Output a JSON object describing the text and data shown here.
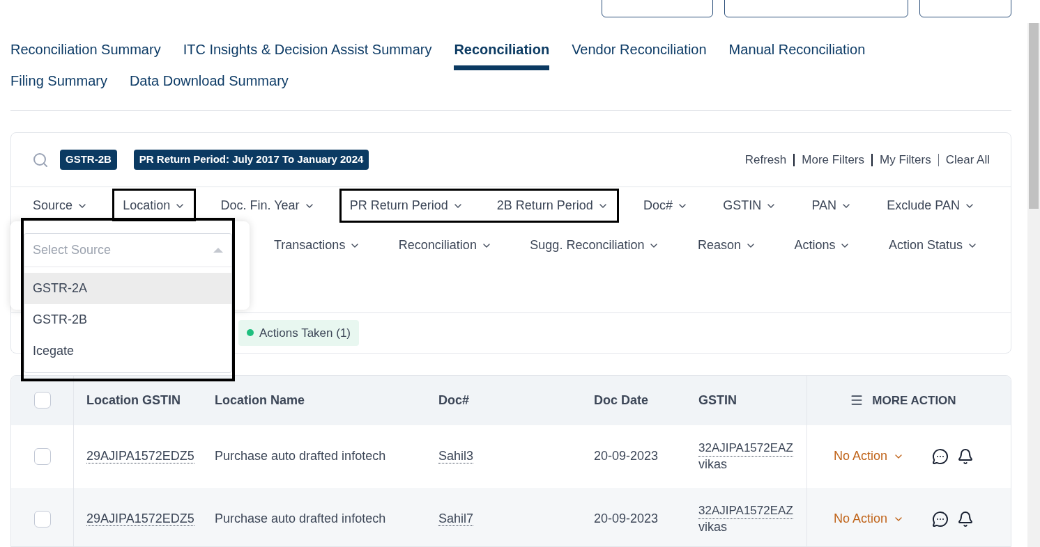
{
  "tabs": [
    {
      "label": "Reconciliation Summary",
      "selected": false
    },
    {
      "label": "ITC Insights & Decision Assist Summary",
      "selected": false
    },
    {
      "label": "Reconciliation",
      "selected": true
    },
    {
      "label": "Vendor Reconciliation",
      "selected": false
    },
    {
      "label": "Manual Reconciliation",
      "selected": false
    },
    {
      "label": "Filing Summary",
      "selected": false
    },
    {
      "label": "Data Download Summary",
      "selected": false
    }
  ],
  "applied_filters": [
    "GSTR-2B",
    "PR Return Period: July 2017 To January 2024"
  ],
  "filter_actions": [
    "Refresh",
    "More Filters",
    "My Filters",
    "Clear All"
  ],
  "filter_rows": [
    [
      {
        "label": "Source",
        "highlighted": false
      },
      {
        "label": "Location",
        "highlighted": true
      },
      {
        "label": "Doc. Fin. Year",
        "highlighted": false
      },
      {
        "label": "PR Return Period",
        "highlighted": true
      },
      {
        "label": "2B Return Period",
        "highlighted": true
      },
      {
        "label": "Doc#",
        "highlighted": false
      },
      {
        "label": "GSTIN",
        "highlighted": false
      },
      {
        "label": "PAN",
        "highlighted": false
      },
      {
        "label": "Exclude PAN",
        "highlighted": false
      }
    ],
    [
      {
        "label": "Transactions",
        "highlighted": false
      },
      {
        "label": "Reconciliation",
        "highlighted": false
      },
      {
        "label": "Sugg. Reconciliation",
        "highlighted": false
      },
      {
        "label": "Reason",
        "highlighted": false
      },
      {
        "label": "Actions",
        "highlighted": false
      },
      {
        "label": "Action Status",
        "highlighted": false
      }
    ]
  ],
  "status_chips": [
    {
      "label": "Actions Taken (1)",
      "color": "#1fbf7f"
    }
  ],
  "source_dropdown": {
    "placeholder": "Select Source",
    "expanded": true,
    "highlighted": true,
    "options": [
      {
        "label": "GSTR-2A",
        "selected": true
      },
      {
        "label": "GSTR-2B",
        "selected": false
      },
      {
        "label": "Icegate",
        "selected": false
      }
    ]
  },
  "table": {
    "columns": [
      "Location GSTIN",
      "Location Name",
      "Doc#",
      "Doc Date",
      "GSTIN"
    ],
    "more_action": "MORE ACTION",
    "header_checked": false,
    "rows": [
      {
        "checked": false,
        "location_gstin": "29AJIPA1572EDZ5",
        "location_name": "Purchase auto drafted infotech",
        "doc": "Sahil3",
        "doc_date": "20-09-2023",
        "gstin": "32AJIPA1572EAZ",
        "gstin_name": "vikas",
        "action": "No Action"
      },
      {
        "checked": false,
        "location_gstin": "29AJIPA1572EDZ5",
        "location_name": "Purchase auto drafted infotech",
        "doc": "Sahil7",
        "doc_date": "20-09-2023",
        "gstin": "32AJIPA1572EAZ",
        "gstin_name": "vikas",
        "action": "No Action"
      }
    ]
  }
}
